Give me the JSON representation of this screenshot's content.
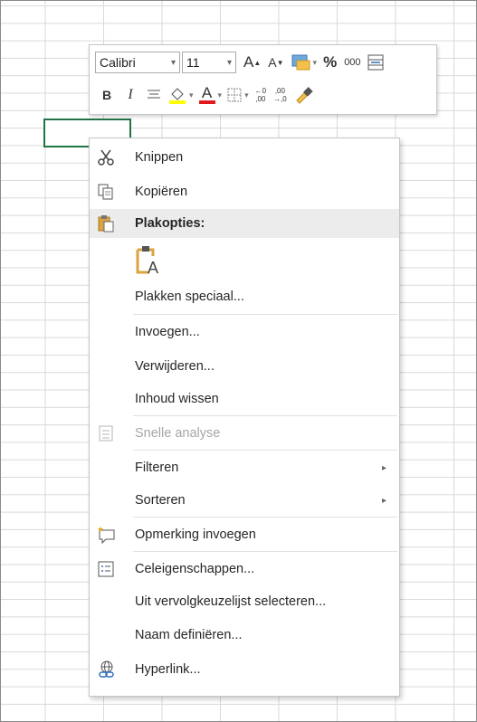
{
  "mini_toolbar": {
    "font_name": "Calibri",
    "font_size": "11",
    "increase_font": "A",
    "decrease_font": "A",
    "percent": "%",
    "thousands": "000",
    "bold": "B",
    "italic": "I",
    "font_color_letter": "A",
    "increase_decimal_top": "←0",
    "increase_decimal_bottom": ",00",
    "decrease_decimal_top": ",00",
    "decrease_decimal_bottom": "→,0"
  },
  "menu": {
    "items": {
      "cut": "Knippen",
      "copy": "Kopiëren",
      "paste_options": "Plakopties:",
      "paste_special": "Plakken speciaal...",
      "insert": "Invoegen...",
      "delete": "Verwijderen...",
      "clear_contents": "Inhoud wissen",
      "quick_analysis": "Snelle analyse",
      "filter": "Filteren",
      "sort": "Sorteren",
      "insert_comment": "Opmerking invoegen",
      "format_cells": "Celeigenschappen...",
      "pick_from_list": "Uit vervolgkeuzelijst selecteren...",
      "define_name": "Naam definiëren...",
      "hyperlink": "Hyperlink..."
    }
  },
  "colors": {
    "selection_border": "#217346",
    "highlight_yellow": "#ffff00",
    "font_red": "#e11b1b",
    "icon_gold": "#d9a441"
  }
}
